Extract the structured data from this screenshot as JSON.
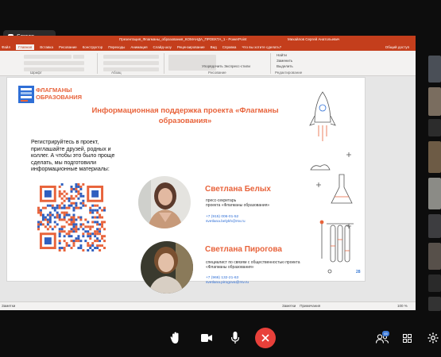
{
  "meeting": {
    "screen_label": "Screen"
  },
  "ppt": {
    "doc_title": "Презентация_Флагманы_образования_КОМАНДА_ПРОЕКТА_1 - PowerPoint",
    "user_name": "Михайлов Сергей Анатольевич",
    "menu_items": [
      "Файл",
      "Главная",
      "Вставка",
      "Рисование",
      "Конструктор",
      "Переходы",
      "Анимация",
      "Слайд-шоу",
      "Рецензирование",
      "Вид",
      "Справка",
      "Что вы хотите сделать?"
    ],
    "share_label": "Общий доступ",
    "ribbon_groups": [
      "Шрифт",
      "Абзац",
      "Рисование",
      "Редактирование"
    ],
    "ribbon_cmds": [
      "Найти",
      "Заменить",
      "Выделить",
      "Упорядочить",
      "Экспресс-стили"
    ],
    "status_left": "Заметки",
    "status_notes": "Заметки",
    "status_comments": "Примечания",
    "zoom": "100 %",
    "slide": {
      "logo_line1": "ФЛАГМАНЫ",
      "logo_line2": "ОБРАЗОВАНИЯ",
      "title": "Информационная поддержка проекта «Флагманы образования»",
      "intro": "Регистрируйтесь в проект, приглашайте друзей, родных и коллег. А чтобы это было проще сделать, мы подготовили информационные материалы:",
      "person1": {
        "name": "Светлана Белых",
        "role_line1": "пресс-секретарь",
        "role_line2": "проекта «Флагманы образования»",
        "phone": "+7 (915) 006-01-52",
        "email": "svetlana.belykh@rsv.ru"
      },
      "person2": {
        "name": "Светлана Пирогова",
        "role_line1": "специалист по связям  с общественностью  проекта",
        "role_line2": "«Флагманы образования»",
        "phone": "+7 (966) 132-21-63",
        "email": "svetlana.pirogova@rsv.ru"
      },
      "page_number": "28"
    }
  },
  "colors": {
    "accent": "#e8633b",
    "ppt_red": "#c43e1c",
    "end_call": "#e8403a",
    "link": "#2f6fd6"
  },
  "right_badge_count": "45"
}
